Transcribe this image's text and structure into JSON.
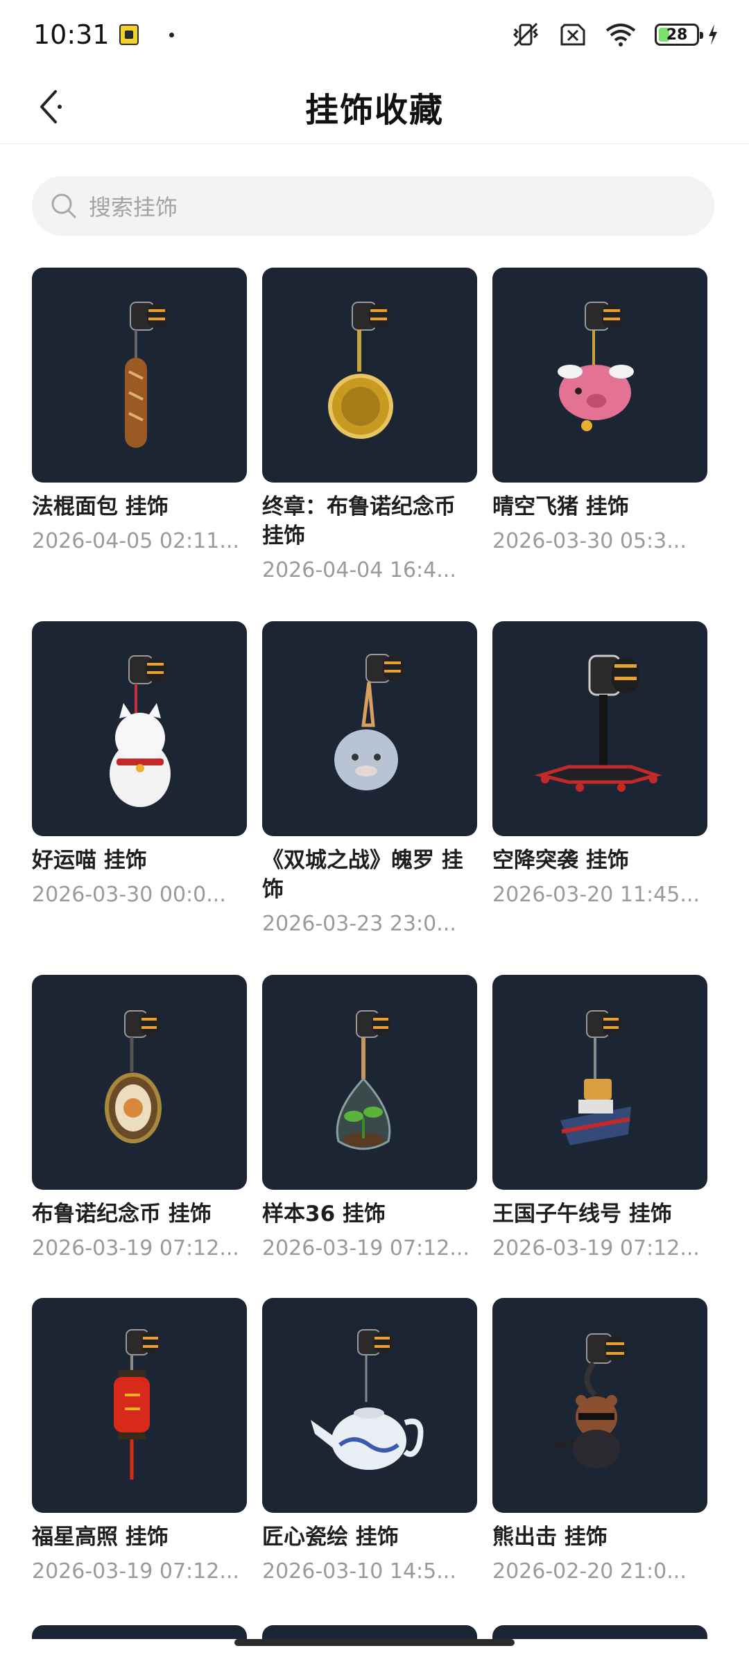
{
  "status": {
    "time": "10:31",
    "battery": "28",
    "battery_level": 0.28
  },
  "header": {
    "title": "挂饰收藏",
    "back_icon": "chevron-left-icon"
  },
  "search": {
    "placeholder": "搜索挂饰",
    "icon": "search-icon"
  },
  "items": [
    {
      "title": "法棍面包 挂饰",
      "date": "2026-04-05 02:11..."
    },
    {
      "title": "终章：布鲁诺纪念币 挂饰",
      "date": "2026-04-04 16:4..."
    },
    {
      "title": "晴空飞猪 挂饰",
      "date": "2026-03-30 05:3..."
    },
    {
      "title": "好运喵 挂饰",
      "date": "2026-03-30 00:0..."
    },
    {
      "title": "《双城之战》魄罗 挂饰",
      "date": "2026-03-23 23:0..."
    },
    {
      "title": "空降突袭 挂饰",
      "date": "2026-03-20 11:45..."
    },
    {
      "title": "布鲁诺纪念币 挂饰",
      "date": "2026-03-19 07:12..."
    },
    {
      "title": "样本36 挂饰",
      "date": "2026-03-19 07:12..."
    },
    {
      "title": "王国子午线号 挂饰",
      "date": "2026-03-19 07:12..."
    },
    {
      "title": "福星高照 挂饰",
      "date": "2026-03-19 07:12..."
    },
    {
      "title": "匠心瓷绘 挂饰",
      "date": "2026-03-10 14:5..."
    },
    {
      "title": "熊出击 挂饰",
      "date": "2026-02-20 21:0..."
    }
  ]
}
